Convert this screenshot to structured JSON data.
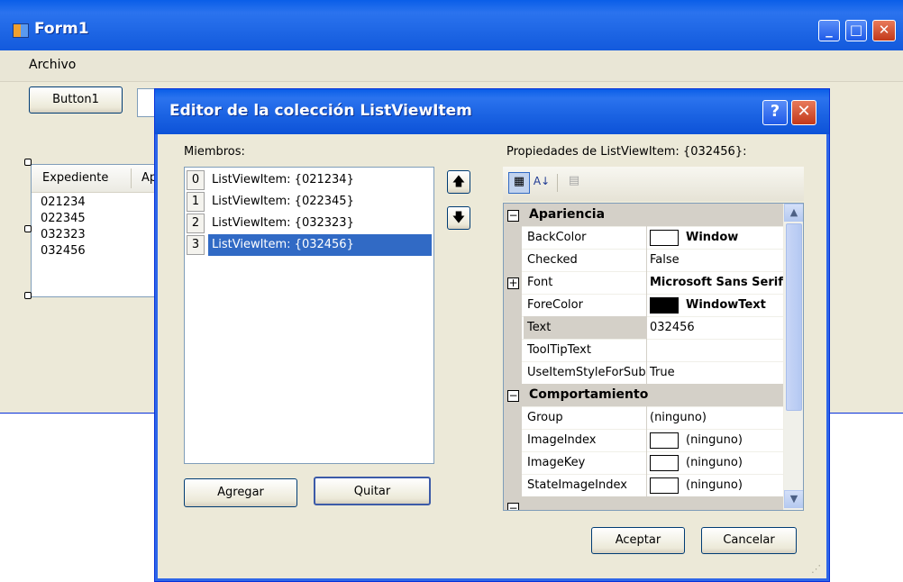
{
  "form1": {
    "title": "Form1",
    "menu": {
      "archivo": "Archivo"
    },
    "button1_label": "Button1",
    "listview": {
      "columns": [
        "Expediente",
        "Ap"
      ],
      "rows": [
        "021234",
        "022345",
        "032323",
        "032456"
      ]
    }
  },
  "dialog": {
    "title": "Editor de la colección ListViewItem",
    "help_glyph": "?",
    "close_glyph": "✕",
    "members_label": "Miembros:",
    "members": [
      {
        "index": "0",
        "text": "ListViewItem: {021234}"
      },
      {
        "index": "1",
        "text": "ListViewItem: {022345}"
      },
      {
        "index": "2",
        "text": "ListViewItem: {032323}"
      },
      {
        "index": "3",
        "text": "ListViewItem: {032456}"
      }
    ],
    "selected_member": 3,
    "add_label": "Agregar",
    "remove_label": "Quitar",
    "properties_label": "Propiedades de ListViewItem: {032456}:",
    "categories": {
      "appearance": "Apariencia",
      "behavior": "Comportamiento"
    },
    "properties": {
      "backcolor": {
        "name": "BackColor",
        "value": "Window"
      },
      "checked": {
        "name": "Checked",
        "value": "False"
      },
      "font": {
        "name": "Font",
        "value": "Microsoft Sans Serif"
      },
      "forecolor": {
        "name": "ForeColor",
        "value": "WindowText"
      },
      "text": {
        "name": "Text",
        "value": "032456"
      },
      "tooltiptext": {
        "name": "ToolTipText",
        "value": ""
      },
      "useitemstyle": {
        "name": "UseItemStyleForSubItems",
        "value": "True"
      },
      "group": {
        "name": "Group",
        "value": "(ninguno)"
      },
      "imageindex": {
        "name": "ImageIndex",
        "value": "(ninguno)"
      },
      "imagekey": {
        "name": "ImageKey",
        "value": "(ninguno)"
      },
      "stateimageindex": {
        "name": "StateImageIndex",
        "value": "(ninguno)"
      }
    },
    "ok_label": "Aceptar",
    "cancel_label": "Cancelar"
  },
  "colors": {
    "titlebar": "#0a5ee8",
    "selection": "#316ac5",
    "window_bg": "#ece9d8"
  }
}
